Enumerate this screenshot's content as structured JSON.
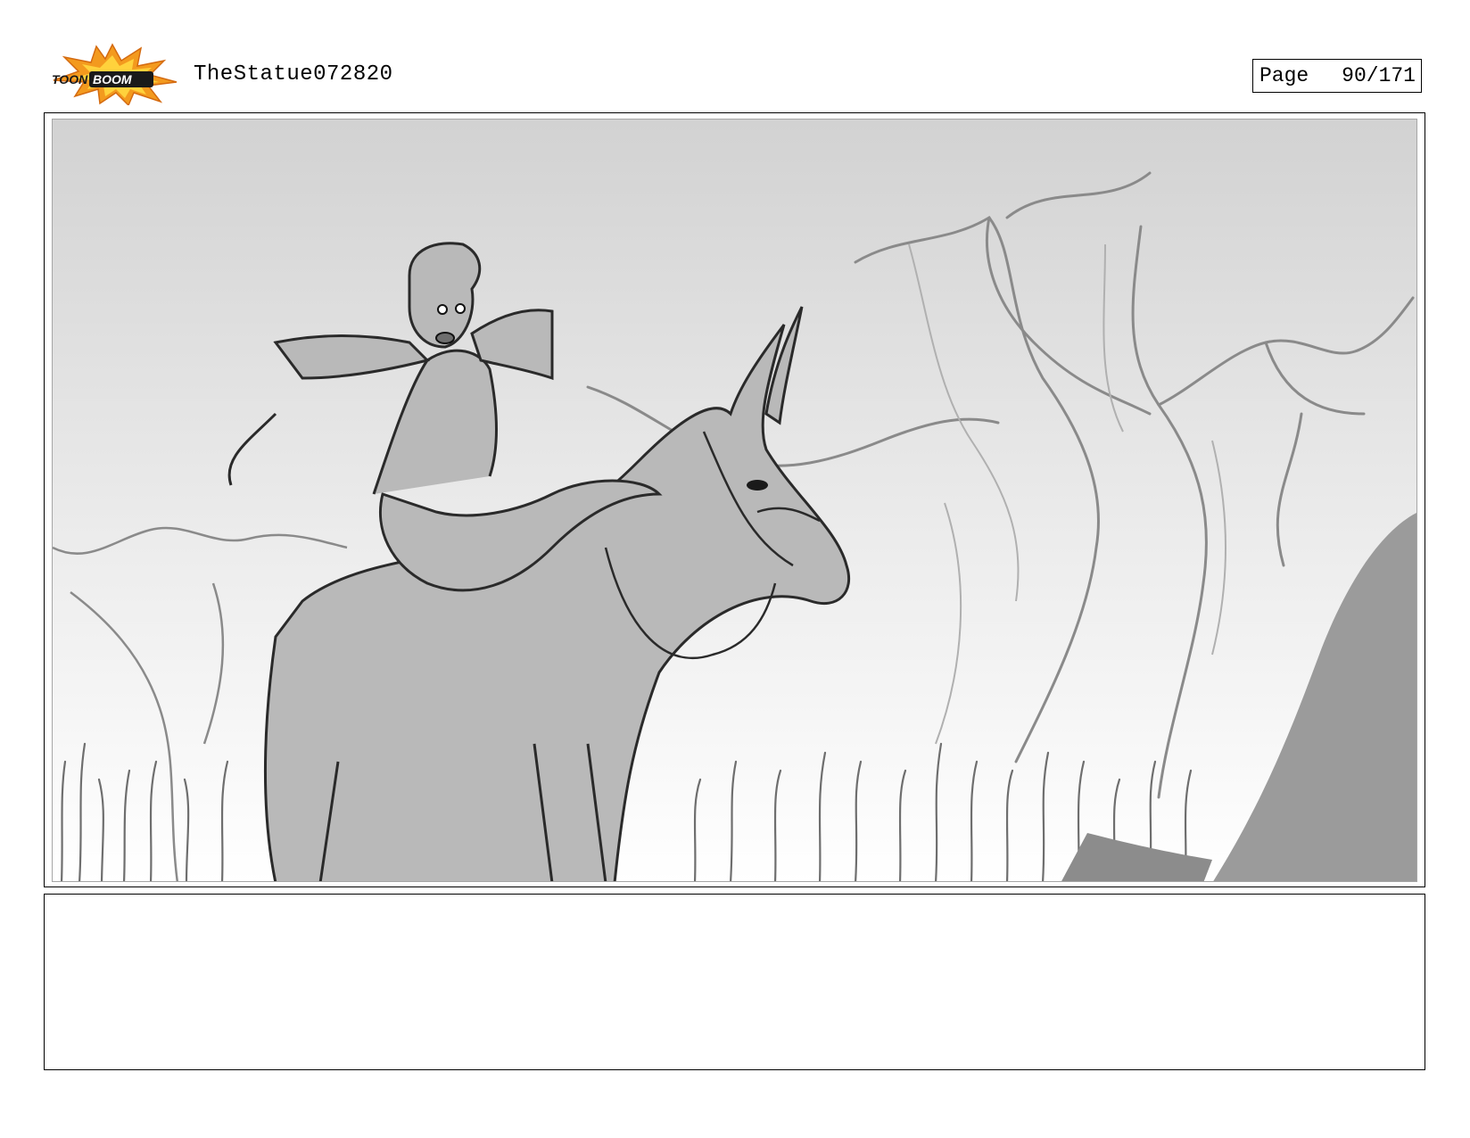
{
  "header": {
    "logo_text": "TOONBOOM",
    "project_title": "TheStatue072820",
    "page_label": "Page",
    "page_number": "90/171"
  },
  "panel": {
    "image_description_icon": "storyboard-sketch-icon"
  },
  "notes": {
    "text": ""
  },
  "colors": {
    "logo_orange": "#f39a1e",
    "logo_yellow": "#ffd23c",
    "sketch_gray": "#b9b9b9",
    "line_gray": "#6e6e6e"
  }
}
